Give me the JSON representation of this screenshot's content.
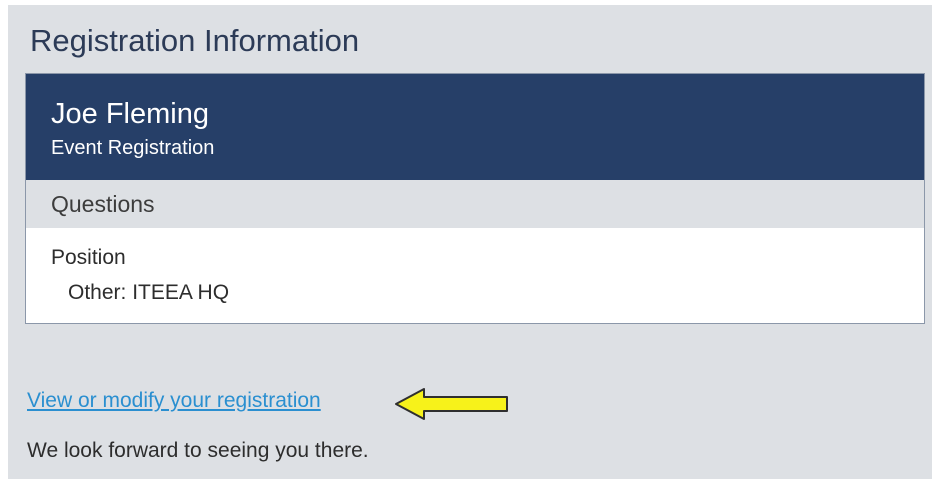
{
  "section": {
    "title": "Registration Information"
  },
  "card": {
    "name": "Joe Fleming",
    "subtitle": "Event Registration",
    "questions_header": "Questions",
    "question": {
      "label": "Position",
      "answer": "Other: ITEEA HQ"
    }
  },
  "footer": {
    "link_label": "View or modify your registration",
    "closing_text": "We look forward to seeing you there."
  },
  "annotation": {
    "icon": "left-arrow-icon",
    "color": "#f7f21a"
  },
  "colors": {
    "header_bg": "#263f68",
    "page_bg": "#dde0e4",
    "link": "#2a8fd0"
  }
}
